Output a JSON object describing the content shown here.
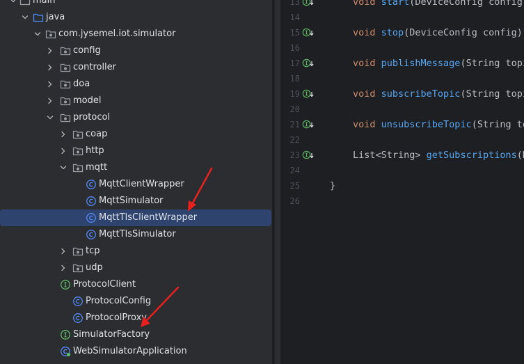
{
  "tree": {
    "items": [
      {
        "label": "main",
        "icon": "folder-icon",
        "expand": "expanded"
      },
      {
        "label": "java",
        "icon": "source-folder-icon",
        "expand": "expanded"
      },
      {
        "label": "com.jysemel.iot.simulator",
        "icon": "package-icon",
        "expand": "expanded"
      },
      {
        "label": "config",
        "icon": "package-icon",
        "expand": "collapsed"
      },
      {
        "label": "controller",
        "icon": "package-icon",
        "expand": "collapsed"
      },
      {
        "label": "doa",
        "icon": "package-icon",
        "expand": "collapsed"
      },
      {
        "label": "model",
        "icon": "package-icon",
        "expand": "collapsed"
      },
      {
        "label": "protocol",
        "icon": "package-icon",
        "expand": "expanded"
      },
      {
        "label": "coap",
        "icon": "package-icon",
        "expand": "collapsed"
      },
      {
        "label": "http",
        "icon": "package-icon",
        "expand": "collapsed"
      },
      {
        "label": "mqtt",
        "icon": "package-icon",
        "expand": "expanded"
      },
      {
        "label": "MqttClientWrapper",
        "icon": "class-icon",
        "expand": "none"
      },
      {
        "label": "MqttSimulator",
        "icon": "class-icon",
        "expand": "none"
      },
      {
        "label": "MqttTlsClientWrapper",
        "icon": "class-icon",
        "expand": "none",
        "selected": true
      },
      {
        "label": "MqttTlsSimulator",
        "icon": "class-icon",
        "expand": "none"
      },
      {
        "label": "tcp",
        "icon": "package-icon",
        "expand": "collapsed"
      },
      {
        "label": "udp",
        "icon": "package-icon",
        "expand": "collapsed"
      },
      {
        "label": "ProtocolClient",
        "icon": "interface-icon",
        "expand": "none"
      },
      {
        "label": "ProtocolConfig",
        "icon": "class-icon",
        "expand": "none"
      },
      {
        "label": "ProtocolProxy",
        "icon": "class-icon",
        "expand": "none"
      },
      {
        "label": "SimulatorFactory",
        "icon": "interface-icon",
        "expand": "none"
      },
      {
        "label": "WebSimulatorApplication",
        "icon": "spring-class-icon",
        "expand": "none"
      },
      {
        "label": "",
        "icon": "folder-icon",
        "expand": "collapsed"
      }
    ]
  },
  "editor": {
    "lines": [
      {
        "number": "13",
        "impl": true,
        "tokens": [
          {
            "t": "void ",
            "c": "kw"
          },
          {
            "t": "start",
            "c": "fn"
          },
          {
            "t": "(DeviceConfig config);",
            "c": "tx"
          }
        ]
      },
      {
        "number": "14",
        "impl": false,
        "tokens": []
      },
      {
        "number": "15",
        "impl": true,
        "tokens": [
          {
            "t": "void ",
            "c": "kw"
          },
          {
            "t": "stop",
            "c": "fn"
          },
          {
            "t": "(DeviceConfig config);",
            "c": "tx"
          }
        ]
      },
      {
        "number": "16",
        "impl": false,
        "tokens": []
      },
      {
        "number": "17",
        "impl": true,
        "tokens": [
          {
            "t": "void ",
            "c": "kw"
          },
          {
            "t": "publishMessage",
            "c": "fn"
          },
          {
            "t": "(String topic",
            "c": "tx"
          }
        ]
      },
      {
        "number": "18",
        "impl": false,
        "tokens": []
      },
      {
        "number": "19",
        "impl": true,
        "tokens": [
          {
            "t": "void ",
            "c": "kw"
          },
          {
            "t": "subscribeTopic",
            "c": "fn"
          },
          {
            "t": "(String topic",
            "c": "tx"
          }
        ]
      },
      {
        "number": "20",
        "impl": false,
        "tokens": []
      },
      {
        "number": "21",
        "impl": true,
        "tokens": [
          {
            "t": "void ",
            "c": "kw"
          },
          {
            "t": "unsubscribeTopic",
            "c": "fn"
          },
          {
            "t": "(String top",
            "c": "tx"
          }
        ]
      },
      {
        "number": "22",
        "impl": false,
        "tokens": []
      },
      {
        "number": "23",
        "impl": true,
        "tokens": [
          {
            "t": "List<String> ",
            "c": "tx"
          },
          {
            "t": "getSubscriptions",
            "c": "fn"
          },
          {
            "t": "(De",
            "c": "tx"
          }
        ]
      },
      {
        "number": "24",
        "impl": false,
        "tokens": []
      },
      {
        "number": "25",
        "impl": false,
        "tokens": [
          {
            "t": "}",
            "c": "tx"
          }
        ]
      },
      {
        "number": "26",
        "impl": false,
        "tokens": []
      }
    ]
  },
  "colors": {
    "tree_bg": "#2b2d30",
    "editor_bg": "#1e1f22",
    "selection": "#2e436e",
    "keyword": "#cf8e6d",
    "function": "#56a8f5",
    "text": "#bcbec4",
    "class_icon": "#548af7",
    "interface_icon": "#5fb865",
    "annotation_arrow": "#e8211f"
  }
}
